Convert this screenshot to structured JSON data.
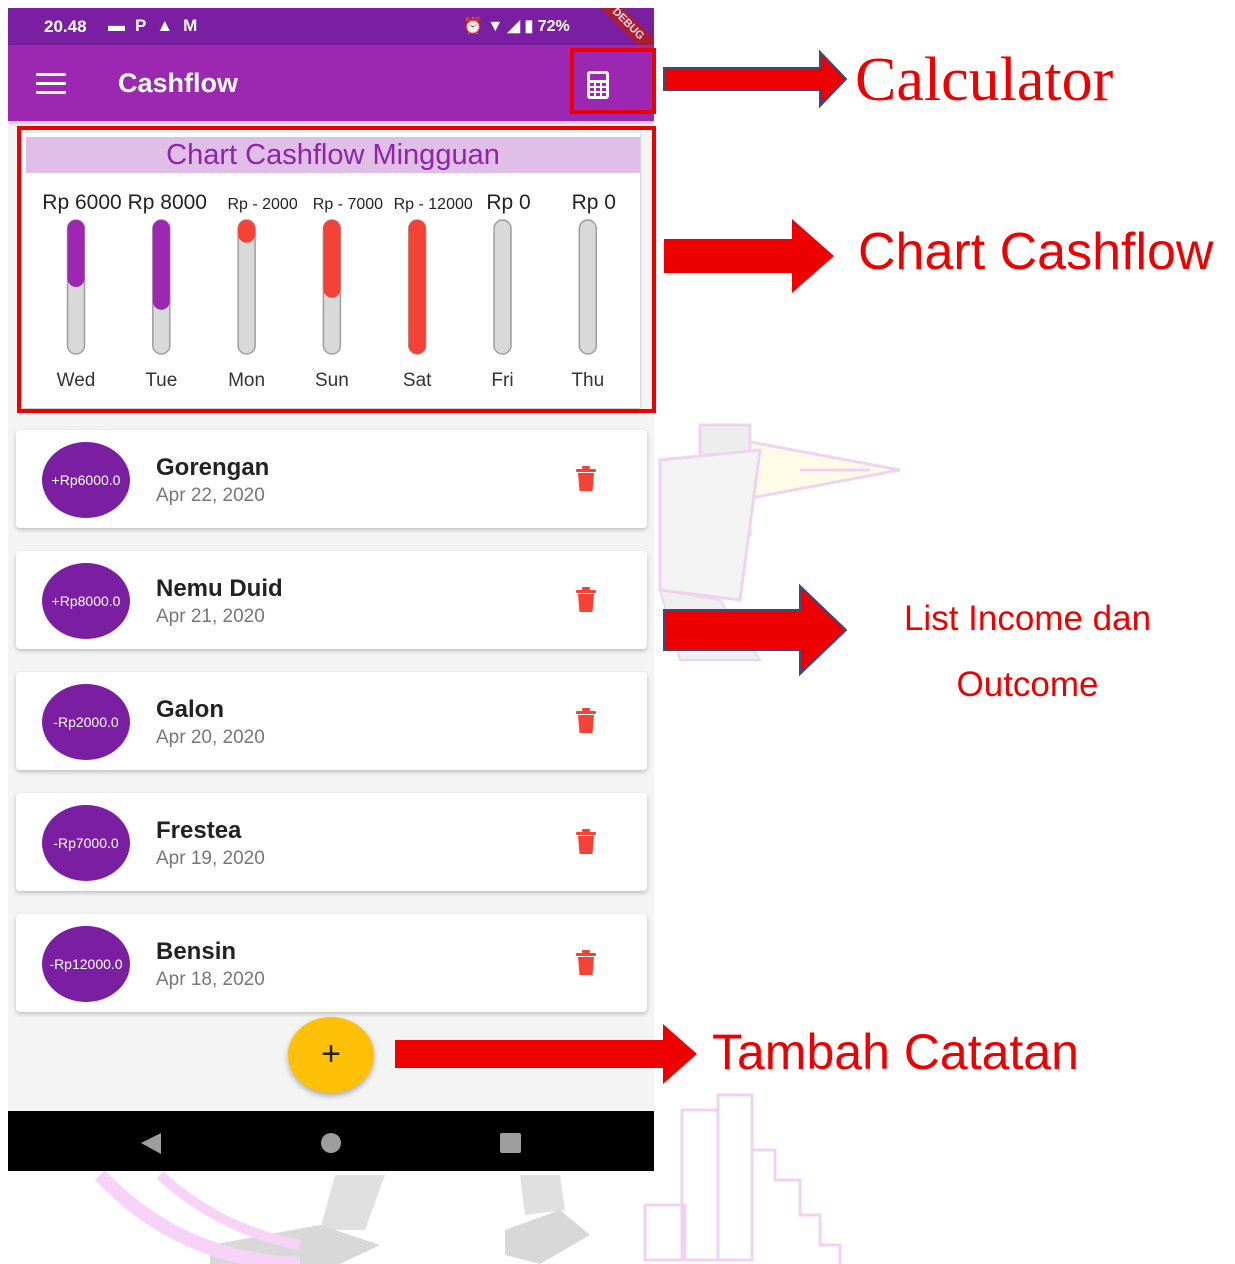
{
  "status_bar": {
    "time": "20.48",
    "left_icons": [
      "message-icon",
      "p-icon",
      "warning-icon",
      "gmail-icon"
    ],
    "battery": "72%",
    "debug_ribbon": "DEBUG"
  },
  "app_bar": {
    "title": "Cashflow",
    "menu_icon": "menu-icon",
    "calculator_icon": "calculator-icon"
  },
  "chart": {
    "title": "Chart Cashflow Mingguan",
    "days": [
      {
        "value_label": "Rp 6000",
        "day": "Wed",
        "fill": 0.5,
        "type": "income"
      },
      {
        "value_label": "Rp 8000",
        "day": "Tue",
        "fill": 0.67,
        "type": "income"
      },
      {
        "value_label": "Rp - 2000",
        "day": "Mon",
        "fill": 0.17,
        "type": "outcome"
      },
      {
        "value_label": "Rp - 7000",
        "day": "Sun",
        "fill": 0.58,
        "type": "outcome"
      },
      {
        "value_label": "Rp - 12000",
        "day": "Sat",
        "fill": 1.0,
        "type": "outcome"
      },
      {
        "value_label": "Rp 0",
        "day": "Fri",
        "fill": 0,
        "type": "none"
      },
      {
        "value_label": "Rp 0",
        "day": "Thu",
        "fill": 0,
        "type": "none"
      }
    ],
    "colors": {
      "income": "#9c27b0",
      "outcome": "#f44336",
      "track": "#d9d9d9"
    }
  },
  "transactions": [
    {
      "amount": "+Rp6000.0",
      "title": "Gorengan",
      "date": "Apr 22, 2020"
    },
    {
      "amount": "+Rp8000.0",
      "title": "Nemu Duid",
      "date": "Apr 21, 2020"
    },
    {
      "amount": "-Rp2000.0",
      "title": "Galon",
      "date": "Apr 20, 2020"
    },
    {
      "amount": "-Rp7000.0",
      "title": "Frestea",
      "date": "Apr 19, 2020"
    },
    {
      "amount": "-Rp12000.0",
      "title": "Bensin",
      "date": "Apr 18, 2020"
    }
  ],
  "fab": {
    "label": "+"
  },
  "nav_bar": {
    "icons": [
      "back-icon",
      "home-icon",
      "recents-icon"
    ]
  },
  "annotations": {
    "calculator": "Calculator",
    "chart": "Chart Cashflow",
    "list_line1": "List Income dan",
    "list_line2": "Outcome",
    "add": "Tambah Catatan"
  },
  "colors": {
    "primary": "#9c27b0",
    "primary_dark": "#7b1fa2",
    "accent": "#ffc107",
    "delete": "#f44336",
    "annotation": "#ee0000"
  }
}
